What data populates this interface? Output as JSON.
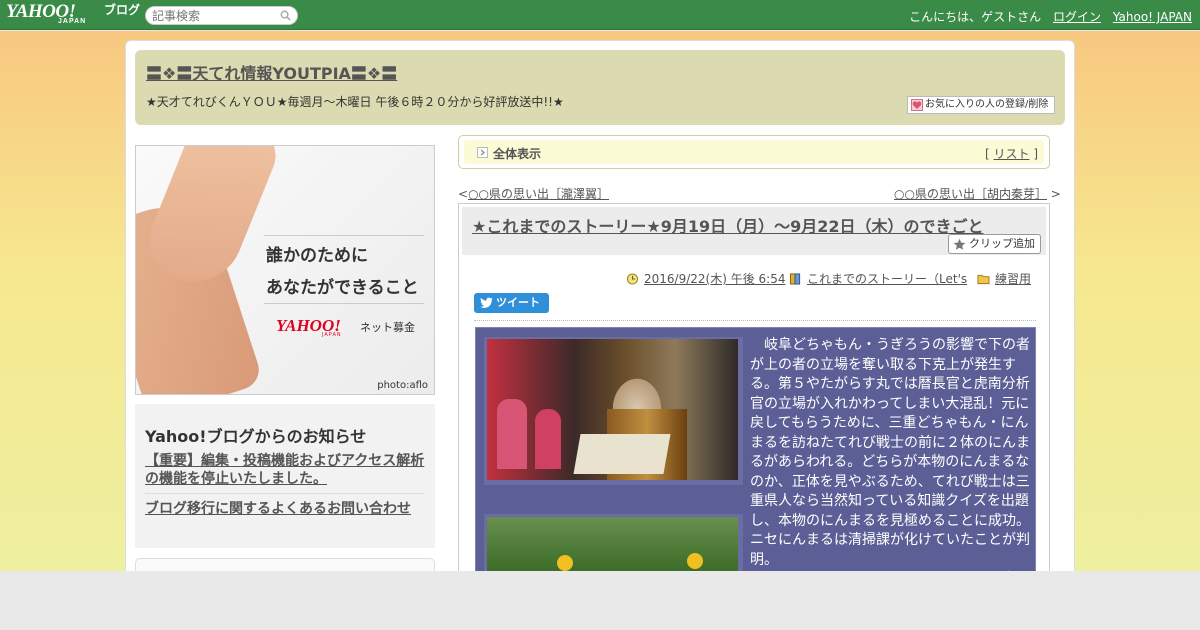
{
  "topbar": {
    "logo_text": "YAHOO!",
    "logo_sub": "JAPAN",
    "logo_blog": "ブログ",
    "search_placeholder": "記事検索",
    "greeting": "こんにちは、ゲストさん",
    "login": "ログイン",
    "yahoo_japan": "Yahoo! JAPAN"
  },
  "header": {
    "blog_title": "〓❖〓天てれ情報YOUTPIA〓❖〓",
    "subtitle": "★天才てれびくんＹＯＵ★毎週月～木曜日 午後６時２０分から好評放送中!!★",
    "fav_button": "お気に入りの人の登録/削除"
  },
  "banner": {
    "line1": "誰かのために",
    "line2": "あなたができること",
    "logo": "YAHOO!",
    "logo_sub": "JAPAN",
    "donation": "ネット募金",
    "credit": "photo:aflo"
  },
  "notice": {
    "heading": "Yahoo!ブログからのお知らせ",
    "items": [
      "【重要】編集・投稿機能およびアクセス解析の機能を停止いたしました。",
      "ブログ移行に関するよくあるお問い合わせ"
    ]
  },
  "viewbar": {
    "label": "全体表示",
    "list_open": "[",
    "list_link": "リスト",
    "list_close": "]"
  },
  "nav": {
    "prev_arrow": "<",
    "prev_link": "○○県の思い出［瀧澤翼］",
    "next_link": "○○県の思い出［胡内秦芽］",
    "next_arrow": ">"
  },
  "article": {
    "title": "★これまでのストーリー★9月19日（月）～9月22日（木）のできごと",
    "clip_button": "クリップ追加",
    "date": "2016/9/22(木) 午後 6:54",
    "category": "これまでのストーリー（Let's",
    "folder": "練習用",
    "tweet": "ツイート",
    "body": "　岐阜どちゃもん・うぎろうの影響で下の者が上の者の立場を奪い取る下克上が発生する。第５やたがらす丸では暦長官と虎南分析官の立場が入れかわってしまい大混乱！元に戻してもらうために、三重どちゃもん・にんまるを訪ねたてれび戦士の前に２体のにんまるがあらわれる。どちらが本物のにんまるなのか、正体を見やぶるため、てれび戦士は三重県人なら当然知っている知識クイズを出題し、本物のにんまるを見極めることに成功。ニセにんまるは清掃課が化けていたことが判明。\n　そしてにんまるの忍術のおかげで暦長官"
  },
  "colors": {
    "topbar": "#3a8a48",
    "header_bg": "#dcdab0",
    "content_bg": "#5c5f96",
    "tweet": "#2f8fd8"
  }
}
